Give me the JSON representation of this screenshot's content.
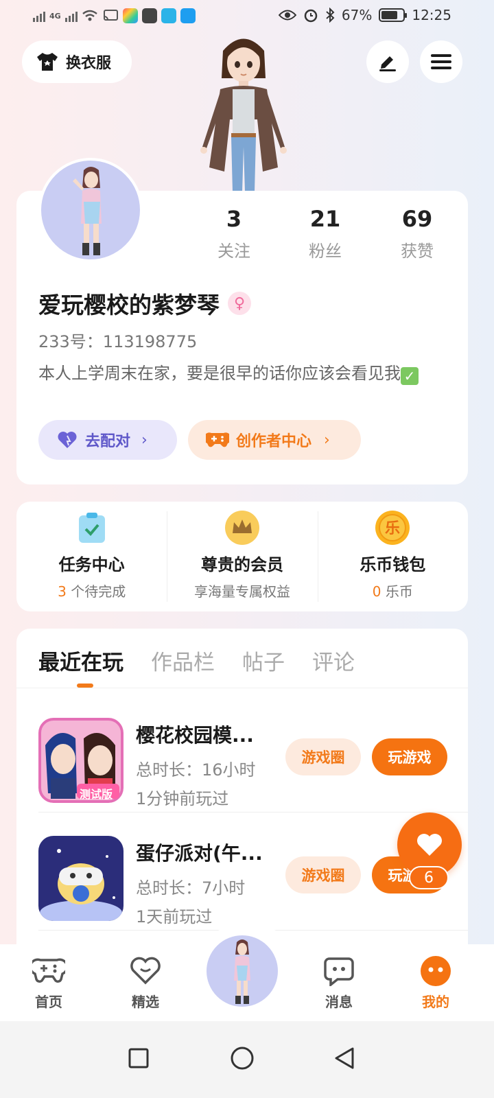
{
  "status_bar": {
    "network_left": "4G",
    "battery": "67%",
    "time": "12:25"
  },
  "header": {
    "dress_label": "换衣服"
  },
  "profile": {
    "stats": [
      {
        "value": "3",
        "label": "关注"
      },
      {
        "value": "21",
        "label": "粉丝"
      },
      {
        "value": "69",
        "label": "获赞"
      }
    ],
    "username": "爱玩樱校的紫梦琴",
    "gender_symbol": "♀",
    "uid": "233号：113198775",
    "bio": "本人上学周末在家，要是很早的话你应该会看见我",
    "match_label": "去配对",
    "creator_label": "创作者中心"
  },
  "features": [
    {
      "title": "任务中心",
      "count": "3",
      "subtitle": "个待完成",
      "icon": "task-icon"
    },
    {
      "title": "尊贵的会员",
      "subtitle": "享海量专属权益",
      "icon": "crown-icon"
    },
    {
      "title": "乐币钱包",
      "count": "0",
      "subtitle": "乐币",
      "icon": "coin-icon",
      "coin_char": "乐"
    }
  ],
  "tabs": [
    "最近在玩",
    "作品栏",
    "帖子",
    "评论"
  ],
  "games": [
    {
      "name": "樱花校园模...",
      "duration": "总时长：16小时",
      "last_played": "1分钟前玩过",
      "icon_badge": "测试版",
      "circle_label": "游戏圈",
      "play_label": "玩游戏"
    },
    {
      "name": "蛋仔派对(午...",
      "duration": "总时长：7小时",
      "last_played": "1天前玩过",
      "circle_label": "游戏圈",
      "play_label": "玩游戏"
    }
  ],
  "fab": {
    "count": "6"
  },
  "bottom_nav": [
    {
      "label": "首页",
      "icon": "gamepad-icon"
    },
    {
      "label": "精选",
      "icon": "heart-outline-icon"
    },
    {
      "label": "消息",
      "icon": "chat-icon"
    },
    {
      "label": "我的",
      "icon": "face-icon",
      "active": true
    }
  ],
  "colors": {
    "accent": "#f27a1a",
    "play_button": "#f57311",
    "match_purple": "#5f58c9"
  }
}
